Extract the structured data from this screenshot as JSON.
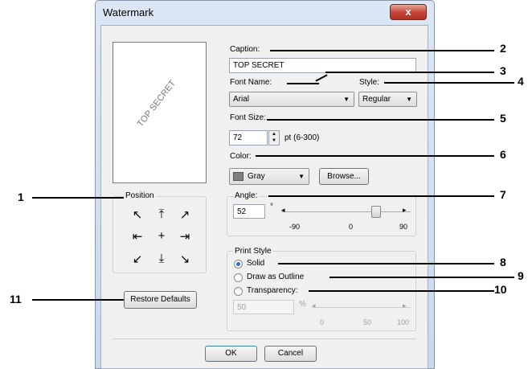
{
  "window": {
    "title": "Watermark",
    "close_glyph": "x"
  },
  "preview": {
    "text": "TOP SECRET"
  },
  "caption": {
    "label": "Caption:",
    "value": "TOP SECRET"
  },
  "font_name": {
    "label": "Font Name:",
    "value": "Arial"
  },
  "style": {
    "label": "Style:",
    "value": "Regular"
  },
  "font_size": {
    "label": "Font Size:",
    "value": "72",
    "hint": "pt (6-300)"
  },
  "color": {
    "label": "Color:",
    "value": "Gray",
    "swatch": "#808080",
    "browse_label": "Browse..."
  },
  "position": {
    "label": "Position",
    "arrows": [
      "↖",
      "⤒",
      "↗",
      "⇤",
      "+",
      "⇥",
      "↙",
      "⤓",
      "↘"
    ]
  },
  "angle": {
    "label": "Angle:",
    "value": "52",
    "unit": "°",
    "min_label": "-90",
    "mid_label": "0",
    "max_label": "90",
    "level_fraction": 0.78
  },
  "print_style": {
    "label": "Print Style",
    "options": [
      "Solid",
      "Draw as Outline",
      "Transparency:"
    ],
    "selected": "Solid",
    "transparency_value": "50",
    "transparency_unit": "%",
    "trans_min": "0",
    "trans_mid": "50",
    "trans_max": "100"
  },
  "restore_defaults_label": "Restore Defaults",
  "ok_label": "OK",
  "cancel_label": "Cancel",
  "callouts": [
    "1",
    "2",
    "3",
    "4",
    "5",
    "6",
    "7",
    "8",
    "9",
    "10",
    "11"
  ]
}
